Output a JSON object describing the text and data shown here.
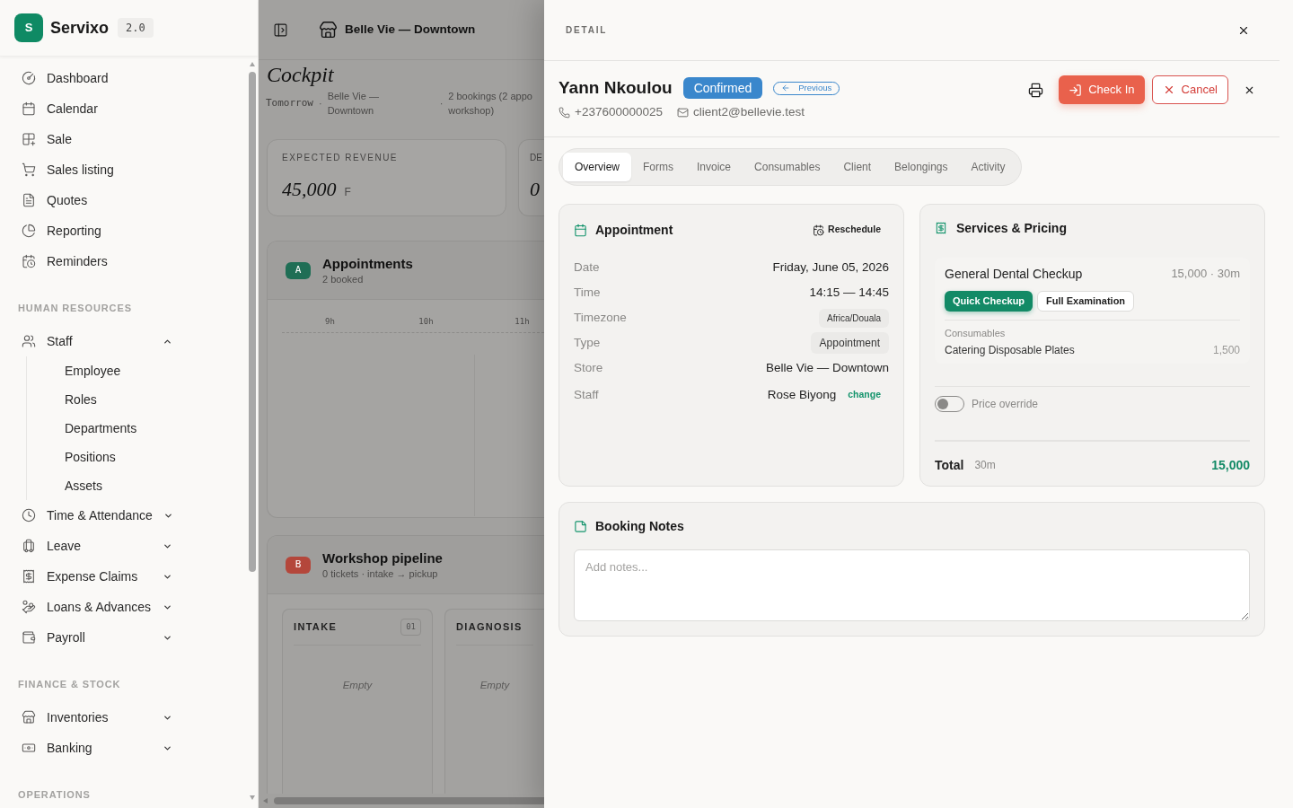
{
  "sidebar": {
    "brand": {
      "logo_letter": "S",
      "name": "Servixo",
      "version": "2.0"
    },
    "sections": [
      {
        "items": [
          {
            "label": "Dashboard"
          },
          {
            "label": "Calendar"
          },
          {
            "label": "Sale"
          },
          {
            "label": "Sales listing"
          },
          {
            "label": "Quotes"
          },
          {
            "label": "Reporting"
          },
          {
            "label": "Reminders"
          }
        ]
      },
      {
        "heading": "HUMAN RESOURCES",
        "items": [
          {
            "label": "Staff",
            "expanded": true,
            "children": [
              {
                "label": "Employee"
              },
              {
                "label": "Roles"
              },
              {
                "label": "Departments"
              },
              {
                "label": "Positions"
              },
              {
                "label": "Assets"
              }
            ]
          },
          {
            "label": "Time & Attendance",
            "expanded": false
          },
          {
            "label": "Leave",
            "expanded": false
          },
          {
            "label": "Expense Claims",
            "expanded": false
          },
          {
            "label": "Loans & Advances",
            "expanded": false
          },
          {
            "label": "Payroll",
            "expanded": false
          }
        ]
      },
      {
        "heading": "FINANCE & STOCK",
        "items": [
          {
            "label": "Inventories",
            "expanded": false
          },
          {
            "label": "Banking",
            "expanded": false
          }
        ]
      },
      {
        "heading": "OPERATIONS"
      }
    ]
  },
  "main": {
    "toolbar": {
      "store": "Belle Vie — Downtown"
    },
    "title": "Cockpit",
    "meta": [
      {
        "kind": "date",
        "lines": [
          "Tomorrow"
        ]
      },
      {
        "kind": "separator",
        "lines": [
          "·"
        ]
      },
      {
        "kind": "info",
        "lines": [
          "Belle Vie —",
          "Downtown"
        ]
      },
      {
        "kind": "separator",
        "lines": [
          "·"
        ]
      },
      {
        "kind": "info",
        "lines": [
          "2 bookings (2 appo",
          "workshop)"
        ]
      }
    ],
    "stats": [
      {
        "label": "EXPECTED REVENUE",
        "value": "45,000",
        "unit": "F"
      },
      {
        "label": "DE",
        "value": "0"
      }
    ],
    "panels": [
      {
        "kind": "timeline",
        "badge": "A",
        "color": "#1f6e55",
        "title": "Appointments",
        "subtitle": "2 booked",
        "axis": [
          "9h",
          "10h",
          "11h"
        ]
      },
      {
        "kind": "pipeline",
        "badge": "B",
        "color": "#b4473b",
        "title": "Workshop pipeline",
        "subtitle": "0 tickets · intake → pickup",
        "columns": [
          {
            "title": "INTAKE",
            "count": "01",
            "empty": "Empty"
          },
          {
            "title": "DIAGNOSIS",
            "empty": "Empty"
          }
        ]
      }
    ]
  },
  "detail": {
    "panel_title": "DETAIL",
    "client": {
      "name": "Yann Nkoulou",
      "status": "Confirmed",
      "previous": "Previous",
      "phone": "+237600000025",
      "email": "client2@bellevie.test"
    },
    "actions": {
      "check_in": "Check In",
      "cancel": "Cancel"
    },
    "tabs": [
      {
        "label": "Overview",
        "selected": true
      },
      {
        "label": "Forms",
        "selected": false
      },
      {
        "label": "Invoice",
        "selected": false
      },
      {
        "label": "Consumables",
        "selected": false
      },
      {
        "label": "Client",
        "selected": false
      },
      {
        "label": "Belongings",
        "selected": false
      },
      {
        "label": "Activity",
        "selected": false
      }
    ],
    "appointment": {
      "title": "Appointment",
      "reschedule": "Reschedule",
      "fields": [
        {
          "kind": "plain",
          "label": "Date",
          "value": "Friday, June 05, 2026"
        },
        {
          "kind": "plain",
          "label": "Time",
          "value": "14:15 — 14:45"
        },
        {
          "kind": "minitag",
          "label": "Timezone",
          "value": "Africa/Douala"
        },
        {
          "kind": "tag",
          "label": "Type",
          "value": "Appointment"
        },
        {
          "kind": "plain",
          "label": "Store",
          "value": "Belle Vie — Downtown"
        },
        {
          "kind": "assignee",
          "label": "Staff",
          "value": "Rose Biyong",
          "action": "change"
        }
      ]
    },
    "services": {
      "title": "Services & Pricing",
      "items": [
        {
          "name": "General Dental Checkup",
          "meta": "15,000 · 30m",
          "variants": [
            {
              "label": "Quick Checkup",
              "selected": true
            },
            {
              "label": "Full Examination",
              "selected": false
            }
          ],
          "consumables_heading": "Consumables",
          "consumables": [
            {
              "name": "Catering Disposable Plates",
              "price": "1,500"
            }
          ]
        }
      ],
      "price_override": {
        "label": "Price override",
        "on": false
      },
      "total": {
        "label": "Total",
        "duration": "30m",
        "amount": "15,000"
      }
    },
    "notes": {
      "title": "Booking Notes",
      "placeholder": "Add notes..."
    }
  }
}
